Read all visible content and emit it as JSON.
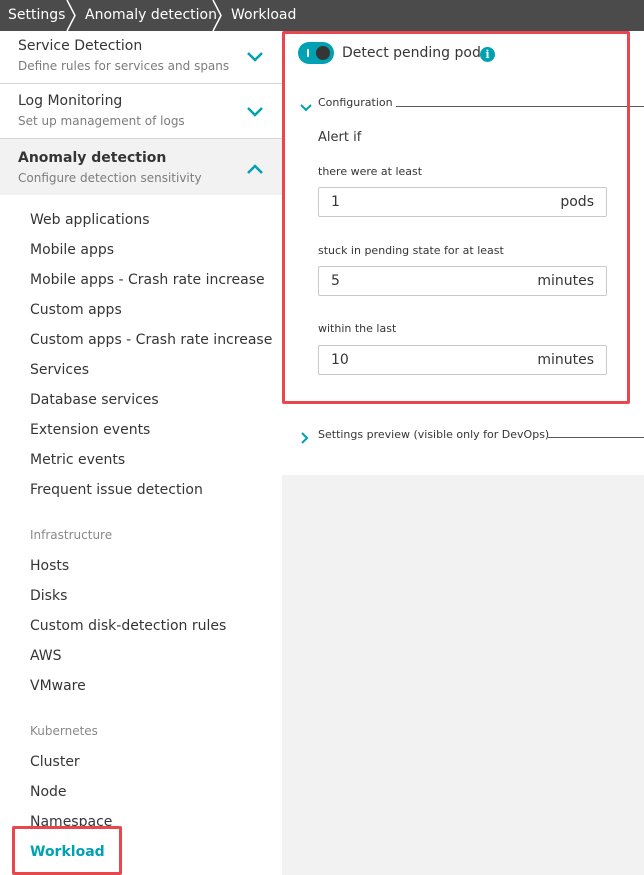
{
  "breadcrumb": [
    {
      "label": "Settings"
    },
    {
      "label": "Anomaly detection"
    },
    {
      "label": "Workload"
    }
  ],
  "sidebar": {
    "accordion": [
      {
        "title": "Service Detection",
        "subtitle": "Define rules for services and spans",
        "expanded": false
      },
      {
        "title": "Log Monitoring",
        "subtitle": "Set up management of logs",
        "expanded": false
      },
      {
        "title": "Anomaly detection",
        "subtitle": "Configure detection sensitivity",
        "expanded": true
      }
    ],
    "links": [
      "Web applications",
      "Mobile apps",
      "Mobile apps - Crash rate increase",
      "Custom apps",
      "Custom apps - Crash rate increase",
      "Services",
      "Database services",
      "Extension events",
      "Metric events",
      "Frequent issue detection"
    ],
    "infrastructure": {
      "heading": "Infrastructure",
      "links": [
        "Hosts",
        "Disks",
        "Custom disk-detection rules",
        "AWS",
        "VMware"
      ]
    },
    "kubernetes": {
      "heading": "Kubernetes",
      "links": [
        "Cluster",
        "Node",
        "Namespace",
        "Workload"
      ],
      "active": "Workload"
    }
  },
  "main": {
    "toggle": {
      "label": "Detect pending pods",
      "enabled": true,
      "info_icon": "i"
    },
    "configuration": {
      "title": "Configuration",
      "alert_if": "Alert if",
      "fields": [
        {
          "label": "there were at least",
          "value": "1",
          "unit": "pods"
        },
        {
          "label": "stuck in pending state for at least",
          "value": "5",
          "unit": "minutes"
        },
        {
          "label": "within the last",
          "value": "10",
          "unit": "minutes"
        }
      ]
    },
    "settings_preview": "Settings preview (visible only for DevOps)"
  },
  "colors": {
    "accent": "#00a1b2",
    "breadcrumb_bg": "#4b4b4b",
    "highlight": "#e8474d"
  }
}
